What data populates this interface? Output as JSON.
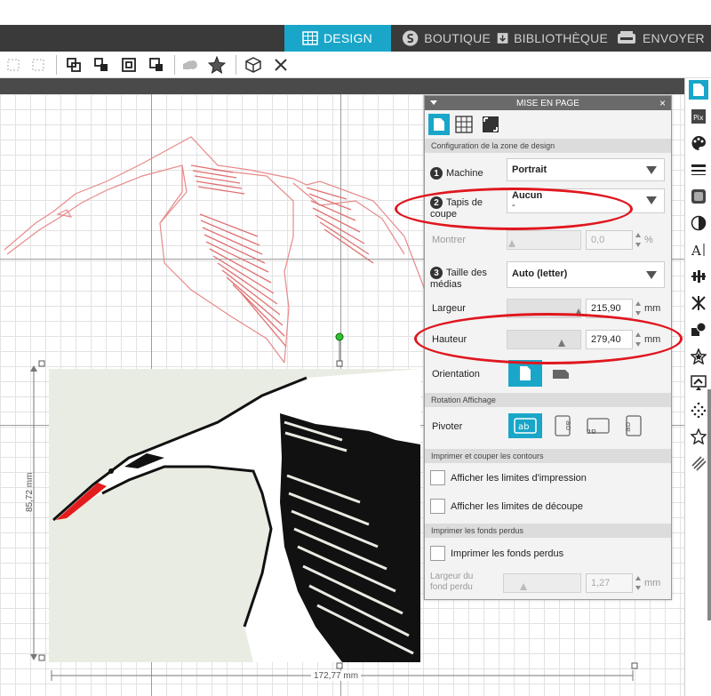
{
  "nav": {
    "tabs": [
      {
        "label": "DESIGN",
        "icon": "grid-icon",
        "active": true
      },
      {
        "label": "BOUTIQUE",
        "icon": "shop-icon",
        "active": false
      },
      {
        "label": "BIBLIOTHÈQUE",
        "icon": "library-icon",
        "active": false
      },
      {
        "label": "ENVOYER",
        "icon": "send-icon",
        "active": false
      }
    ]
  },
  "panel": {
    "title": "MISE EN PAGE",
    "close": "×",
    "section_config": "Configuration de la zone de design",
    "machine": {
      "num": "1",
      "label": "Machine",
      "value": "Portrait"
    },
    "mat": {
      "num": "2",
      "label": "Tapis de coupe",
      "value": "Aucun",
      "value2": "-"
    },
    "show": {
      "label": "Montrer",
      "value": "0,0",
      "unit": "%"
    },
    "media": {
      "num": "3",
      "label": "Taille des médias",
      "value": "Auto (letter)"
    },
    "width": {
      "label": "Largeur",
      "value": "215,90",
      "unit": "mm"
    },
    "height": {
      "label": "Hauteur",
      "value": "279,40",
      "unit": "mm"
    },
    "orientation": {
      "label": "Orientation"
    },
    "section_rotation": "Rotation Affichage",
    "rotate": {
      "label": "Pivoter"
    },
    "section_print": "Imprimer et couper les contours",
    "print_limits": "Afficher les limites d'impression",
    "cut_limits": "Afficher les limites de découpe",
    "section_bleed": "Imprimer les fonds perdus",
    "bleed": "Imprimer les fonds perdus",
    "bleed_width": {
      "label": "Largeur du fond perdu",
      "value": "1,27",
      "unit": "mm"
    }
  },
  "dimensions": {
    "width": "172,77 mm",
    "height": "85,72 mm"
  },
  "colors": {
    "accent": "#19a6c9",
    "highlight": "#e0161e",
    "trace": "#e88a8a"
  }
}
